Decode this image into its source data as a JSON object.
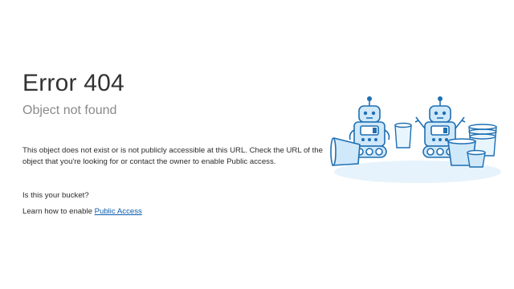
{
  "error": {
    "title": "Error 404",
    "subtitle": "Object not found",
    "message": "This object does not exist or is not publicly accessible at this URL. Check the URL of the object that you're looking for or contact the owner to enable Public access.",
    "bucket_question": "Is this your bucket?",
    "learn_prefix": "Learn how to enable ",
    "learn_link": "Public Access"
  },
  "colors": {
    "link": "#0b5cad",
    "robot_outline": "#1f6fb2",
    "robot_fill": "#cfe8fa",
    "floor": "#e6f3fc"
  },
  "illustration": {
    "icon": "robots-with-buckets-illustration"
  }
}
